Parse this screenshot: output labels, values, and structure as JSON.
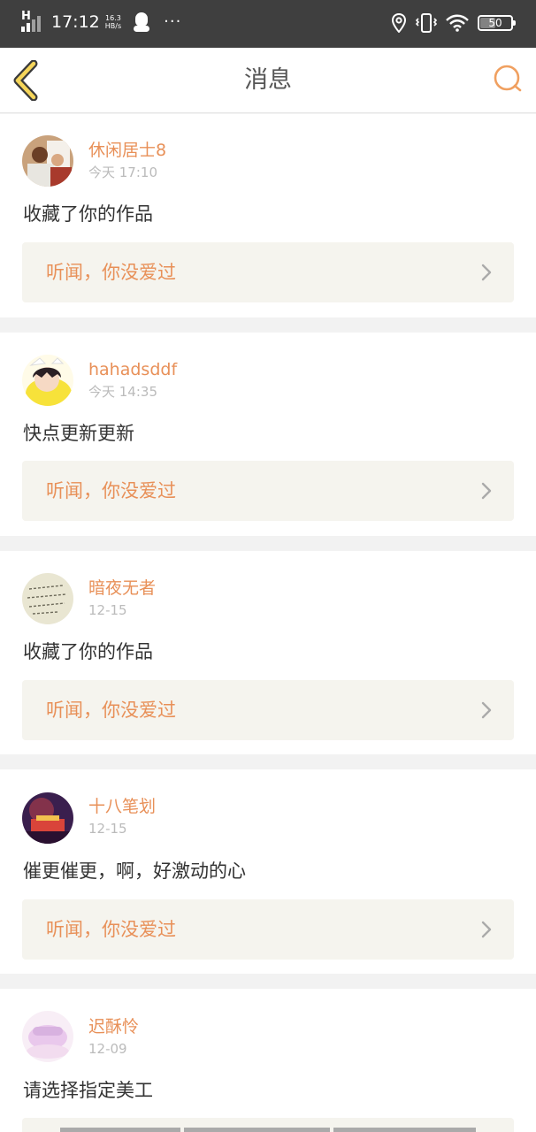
{
  "status_bar": {
    "signal_label": "H",
    "time": "17:12",
    "net_speed_value": "16.3",
    "net_speed_unit": "HB/s",
    "more_dots": "···",
    "battery_level": "50"
  },
  "header": {
    "title": "消息",
    "back_icon": "chevron-left-icon",
    "search_icon": "search-icon"
  },
  "messages": [
    {
      "user": "休闲居士8",
      "time": "今天 17:10",
      "text": "收藏了你的作品",
      "work": "听闻，你没爱过"
    },
    {
      "user": "hahadsddf",
      "time": "今天 14:35",
      "text": "快点更新更新",
      "work": "听闻，你没爱过"
    },
    {
      "user": "暗夜无者",
      "time": "12-15",
      "text": "收藏了你的作品",
      "work": "听闻，你没爱过"
    },
    {
      "user": "十八笔划",
      "time": "12-15",
      "text": "催更催更，啊，好激动的心",
      "work": "听闻，你没爱过"
    },
    {
      "user": "迟酥怜",
      "time": "12-09",
      "text": "请选择指定美工",
      "work": ""
    }
  ],
  "colors": {
    "accent": "#e89058",
    "status_bar_bg": "#3f3f3f",
    "card_inner_bg": "#f5f4ee",
    "back_icon_fill": "#f5d55a"
  }
}
